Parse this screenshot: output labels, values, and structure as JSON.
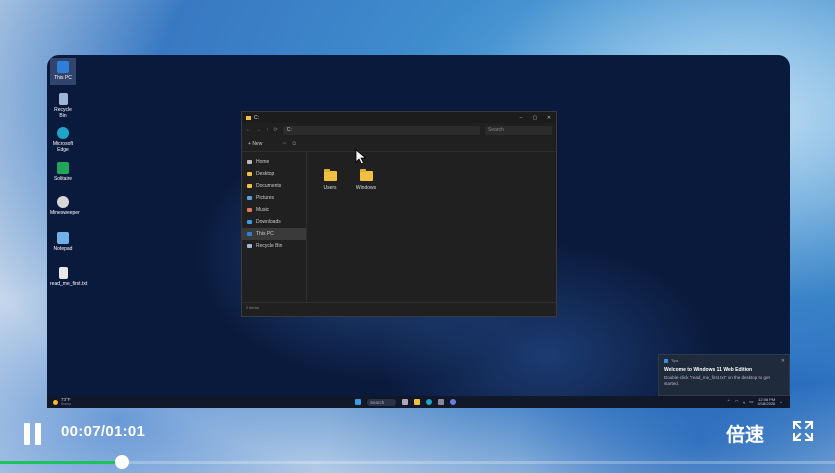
{
  "desktop_icons": [
    {
      "label": "This PC",
      "icon": "monitor-icon",
      "color": "#2d7fd8"
    },
    {
      "label": "Recycle Bin",
      "icon": "recycle-bin-icon",
      "color": "#9fb7d6"
    },
    {
      "label": "Microsoft Edge",
      "icon": "edge-icon",
      "color": "#1fa3c9"
    },
    {
      "label": "Solitaire",
      "icon": "solitaire-icon",
      "color": "#22a55a"
    },
    {
      "label": "Minesweeper",
      "icon": "minesweeper-icon",
      "color": "#d8d8d8"
    },
    {
      "label": "Notepad",
      "icon": "notepad-icon",
      "color": "#6fb2ea"
    },
    {
      "label": "read_me_first.txt",
      "icon": "text-file-icon",
      "color": "#e8e8e8"
    }
  ],
  "explorer": {
    "title": "C:",
    "path": "C:",
    "search_placeholder": "Search",
    "new_label": "New",
    "nav": [
      {
        "label": "Home",
        "color": "#bbb"
      },
      {
        "label": "Desktop",
        "color": "#f0c040"
      },
      {
        "label": "Documents",
        "color": "#f0c040"
      },
      {
        "label": "Pictures",
        "color": "#5aa0e0"
      },
      {
        "label": "Music",
        "color": "#e07a5a"
      },
      {
        "label": "Downloads",
        "color": "#3c9be0"
      },
      {
        "label": "This PC",
        "color": "#2d7fd8"
      },
      {
        "label": "Recycle Bin",
        "color": "#9fb7d6"
      }
    ],
    "active_nav": "This PC",
    "folders": [
      "Users",
      "Windows"
    ],
    "status": "2 items"
  },
  "toast": {
    "app": "Tips",
    "title": "Welcome to Windows 11 Web Edition",
    "body": "Double-click \"read_me_first.txt\" on the desktop to get started."
  },
  "taskbar": {
    "weather": "73°F",
    "weather_sub": "Sunny",
    "search_label": "Search",
    "time": "12:06 PM",
    "date": "4/18/2026"
  },
  "player": {
    "current_time": "00:07",
    "duration": "01:01",
    "time_display": "00:07/01:01",
    "speed_label": "倍速",
    "progress_fraction": 0.146,
    "accent": "#1fc15b"
  }
}
